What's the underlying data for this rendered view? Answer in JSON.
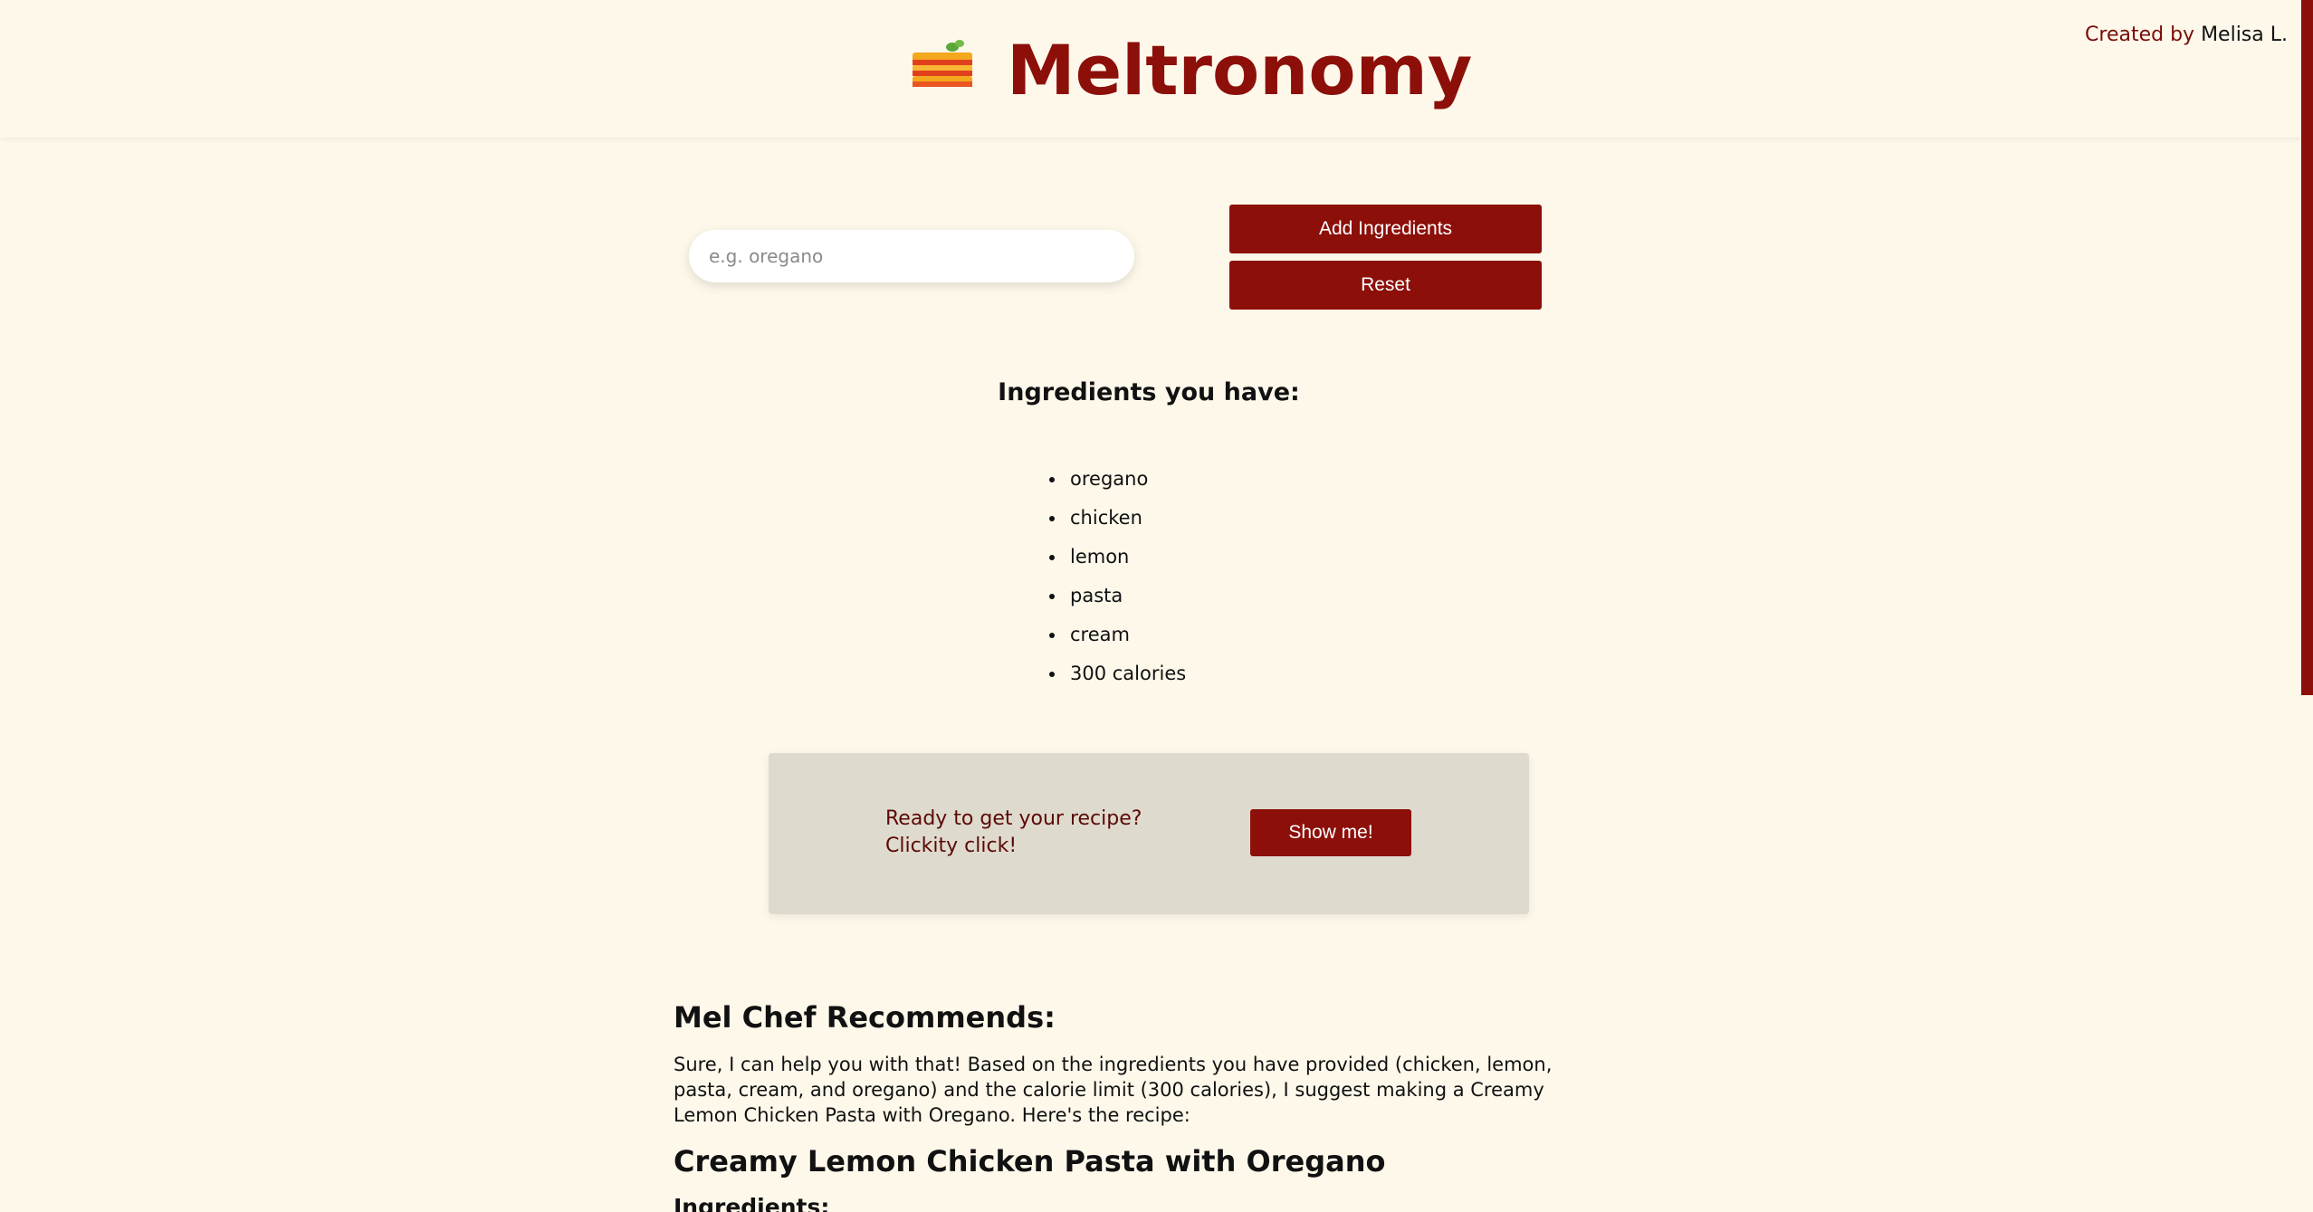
{
  "header": {
    "title": "Meltronomy",
    "logo_icon": "lasagna-icon",
    "credit_label": "Created by",
    "credit_name": "Melisa L."
  },
  "form": {
    "input_placeholder": "e.g. oregano",
    "input_value": "",
    "add_button_label": "Add Ingredients",
    "reset_button_label": "Reset"
  },
  "ingredients": {
    "heading": "Ingredients you have:",
    "items": [
      "oregano",
      "chicken",
      "lemon",
      "pasta",
      "cream",
      "300 calories"
    ]
  },
  "cta": {
    "line1": "Ready to get your recipe?",
    "line2": "Clickity click!",
    "button_label": "Show me!"
  },
  "recommendation": {
    "heading": "Mel Chef Recommends:",
    "intro": "Sure, I can help you with that! Based on the ingredients you have provided (chicken, lemon, pasta, cream, and oregano) and the calorie limit (300 calories), I suggest making a Creamy Lemon Chicken Pasta with Oregano. Here's the recipe:",
    "recipe_title": "Creamy Lemon Chicken Pasta with Oregano",
    "ingredients_subheading": "Ingredients:"
  },
  "colors": {
    "accent": "#8c0f0a",
    "background": "#fdf8ea",
    "cta_background": "#dfdace"
  }
}
